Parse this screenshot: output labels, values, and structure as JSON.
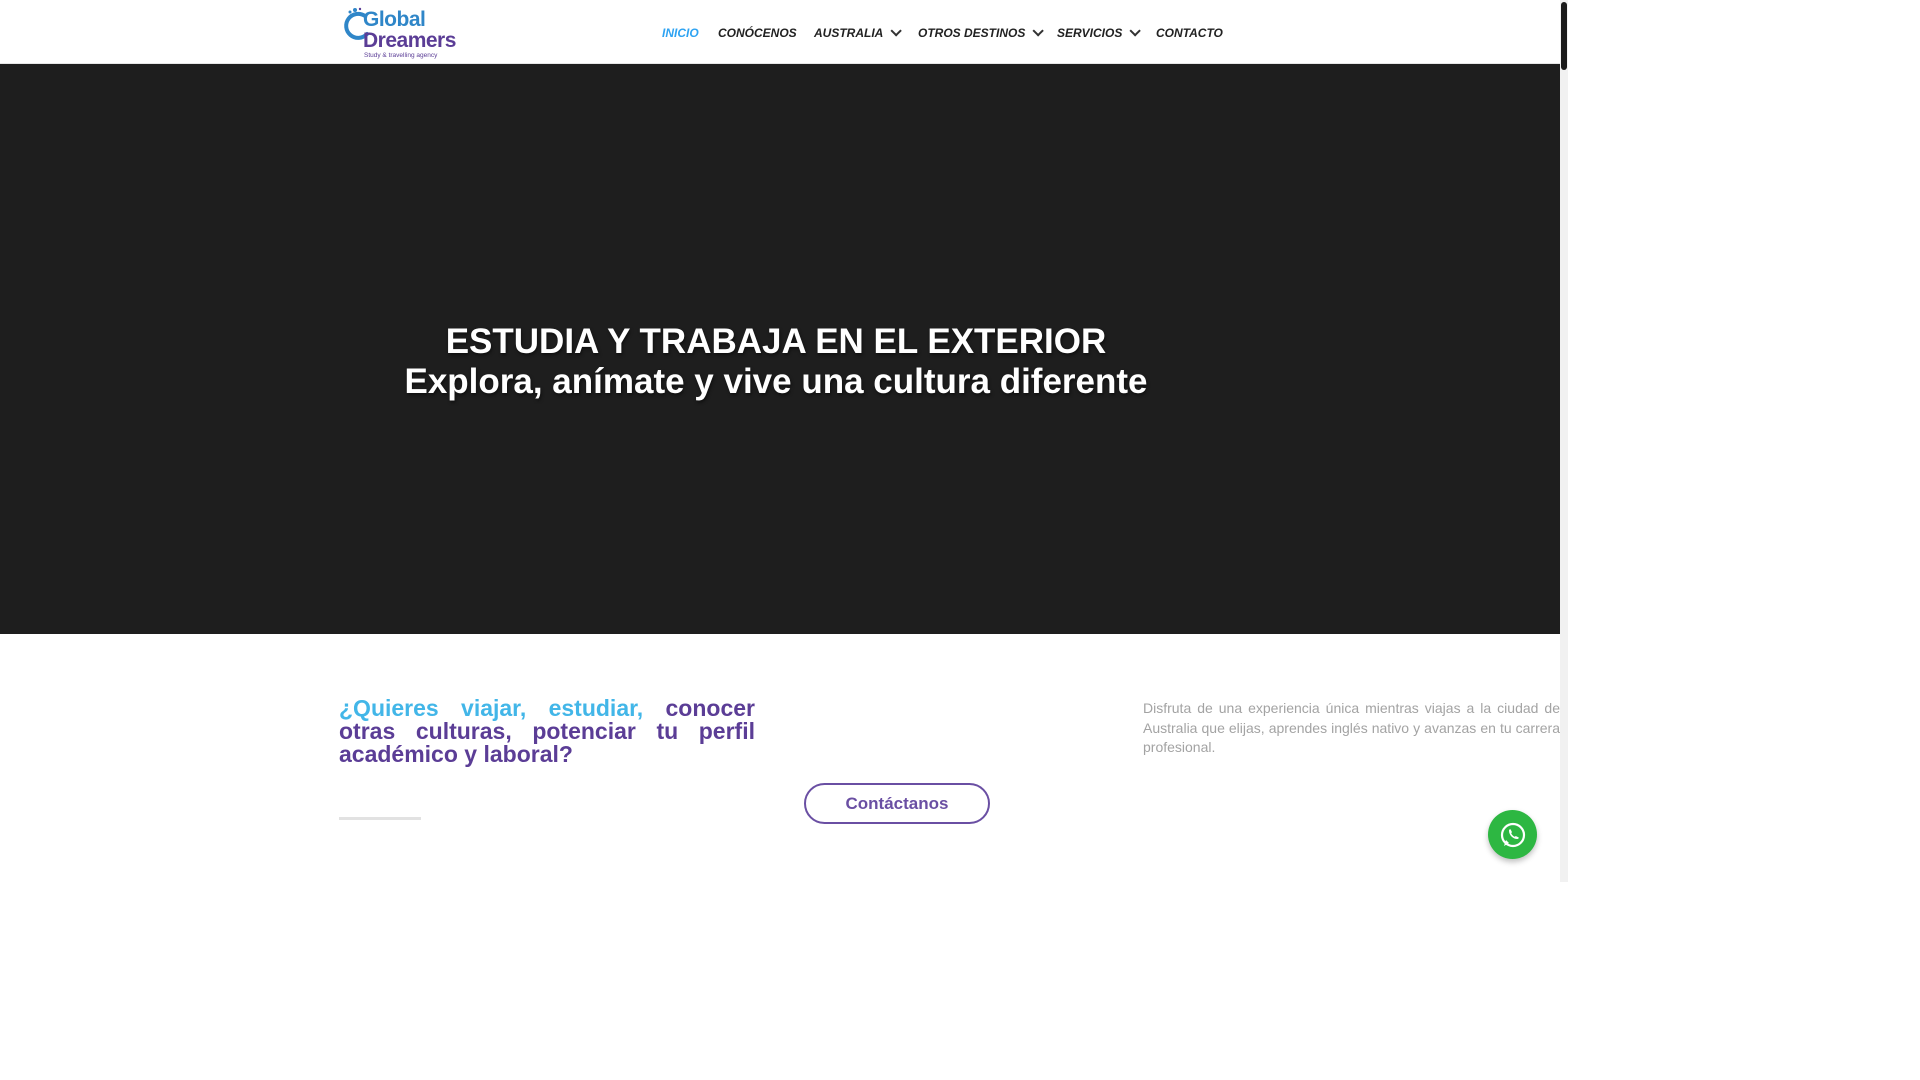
{
  "header": {
    "logo": {
      "line1": "Global",
      "line2": "Dreamers",
      "tagline": "Study & travelling agency"
    },
    "nav": [
      {
        "label": "INICIO",
        "active": true
      },
      {
        "label": "CONÓCENOS"
      },
      {
        "label": "AUSTRALIA",
        "dropdown": true
      },
      {
        "label": "OTROS DESTINOS",
        "dropdown": true
      },
      {
        "label": "SERVICIOS",
        "dropdown": true
      },
      {
        "label": "CONTACTO"
      }
    ]
  },
  "hero": {
    "title": "ESTUDIA Y TRABAJA EN EL EXTERIOR",
    "subtitle": "Explora, anímate y vive una cultura diferente"
  },
  "intro": {
    "question_blue": "¿Quieres viajar, estudiar,",
    "question_purple": "conocer otras culturas, potenciar tu perfil académico y laboral?",
    "button": "Contáctanos",
    "description": "Disfruta de una experiencia única mientras viajas a la ciudad de Australia que elijas, aprendes inglés nativo y avanzas en tu carrera profesional."
  },
  "icons": {
    "whatsapp": "whatsapp-icon",
    "chevron": "chevron-down-icon"
  },
  "colors": {
    "accent_blue": "#2ea3f2",
    "brand_purple": "#5b3d96",
    "hero_bg": "#1e1e1e",
    "whatsapp_green": "#2db742"
  }
}
